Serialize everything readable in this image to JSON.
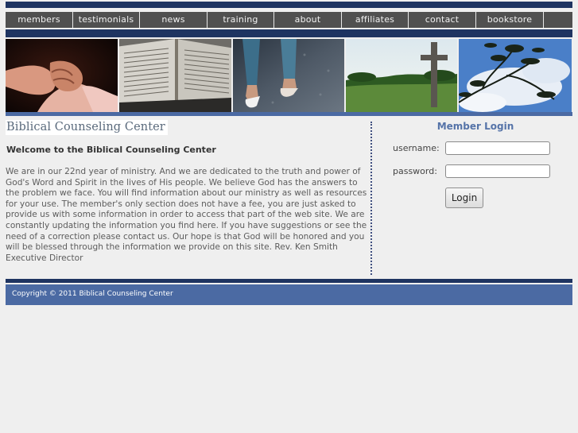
{
  "nav": {
    "items": [
      {
        "label": "members"
      },
      {
        "label": "testimonials"
      },
      {
        "label": "news"
      },
      {
        "label": "training"
      },
      {
        "label": "about"
      },
      {
        "label": "affiliates"
      },
      {
        "label": "contact"
      },
      {
        "label": "bookstore"
      }
    ]
  },
  "banner": {
    "panels": [
      {
        "subject": "clasped-hands"
      },
      {
        "subject": "open-bible"
      },
      {
        "subject": "walking-feet"
      },
      {
        "subject": "cross-on-hill"
      },
      {
        "subject": "tree-against-sky"
      }
    ]
  },
  "site": {
    "logo_text": "Biblical Counseling Center"
  },
  "main": {
    "heading": "Welcome to the Biblical Counseling Center",
    "body": "We are in our 22nd year of ministry. And we are dedicated to the truth and power of God's Word and Spirit in the lives of His people. We believe God has the answers to the problem we face. You will find information about our ministry as well as resources for your use. The member's only section does not have a fee, you are just asked to provide us with some information in order to access that part of the web site. We are constantly updating the information you find here. If you have suggestions or see the need of a correction please contact us. Our hope is that God will be honored and you will be blessed through the information we provide on this site. Rev. Ken Smith Executive Director"
  },
  "login": {
    "title": "Member Login",
    "username_label": "username:",
    "username_value": "",
    "password_label": "password:",
    "password_value": "",
    "button_label": "Login"
  },
  "footer": {
    "copyright": "Copyright © 2011 Biblical Counseling Center"
  },
  "colors": {
    "dark_navy": "#1e3461",
    "accent_blue": "#4b6aa3",
    "nav_gray": "#505050",
    "login_title": "#5573a8"
  }
}
